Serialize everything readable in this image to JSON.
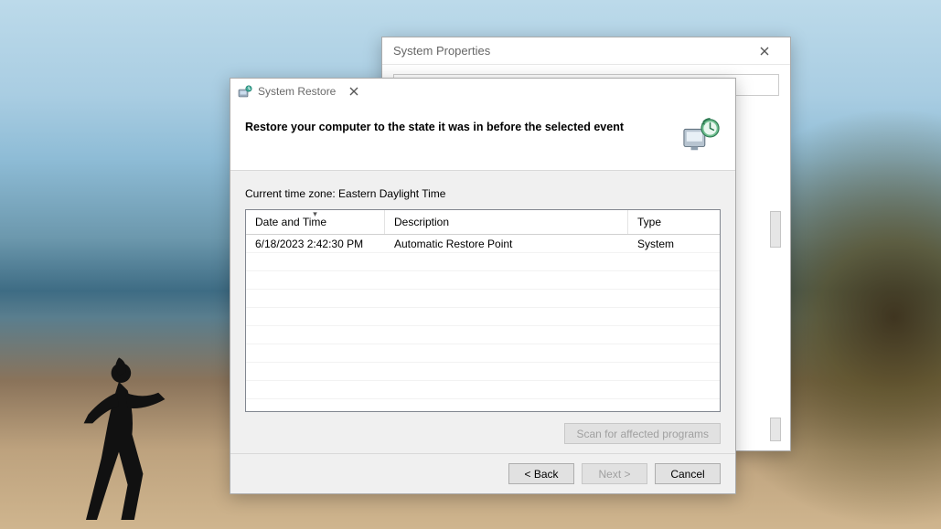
{
  "parent_window": {
    "title": "System Properties"
  },
  "dialog": {
    "title": "System Restore",
    "headline": "Restore your computer to the state it was in before the selected event",
    "timezone_label": "Current time zone: Eastern Daylight Time",
    "columns": {
      "datetime": "Date and Time",
      "description": "Description",
      "type": "Type"
    },
    "restore_points": [
      {
        "datetime": "6/18/2023 2:42:30 PM",
        "description": "Automatic Restore Point",
        "type": "System"
      }
    ],
    "scan_button": "Scan for affected programs",
    "buttons": {
      "back": "< Back",
      "next": "Next >",
      "cancel": "Cancel"
    }
  }
}
